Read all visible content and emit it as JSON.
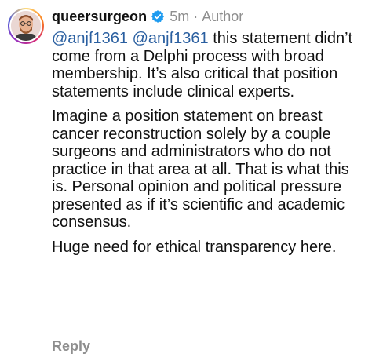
{
  "comment": {
    "username": "queersurgeon",
    "time": "5m",
    "role": "Author",
    "mentions": [
      "@anjf1361",
      "@anjf1361"
    ],
    "paragraph1_rest": " this statement didn’t come from a Delphi process with broad membership. It’s also critical that position statements include clinical experts.",
    "paragraph2": "Imagine a position statement on breast cancer reconstruction solely by a couple surgeons and administrators who do not practice in that area at all. That is what this is. Personal opinion and political pressure presented as if it’s scientific and academic consensus.",
    "paragraph3": "Huge need for ethical transparency here.",
    "reply_label": "Reply"
  },
  "icons": {
    "verified": "verified-badge-icon",
    "avatar": "profile-avatar"
  },
  "colors": {
    "mention": "#2a5fa0",
    "verified": "#1d9bf0",
    "muted": "#8e8e8e",
    "text": "#111111"
  }
}
